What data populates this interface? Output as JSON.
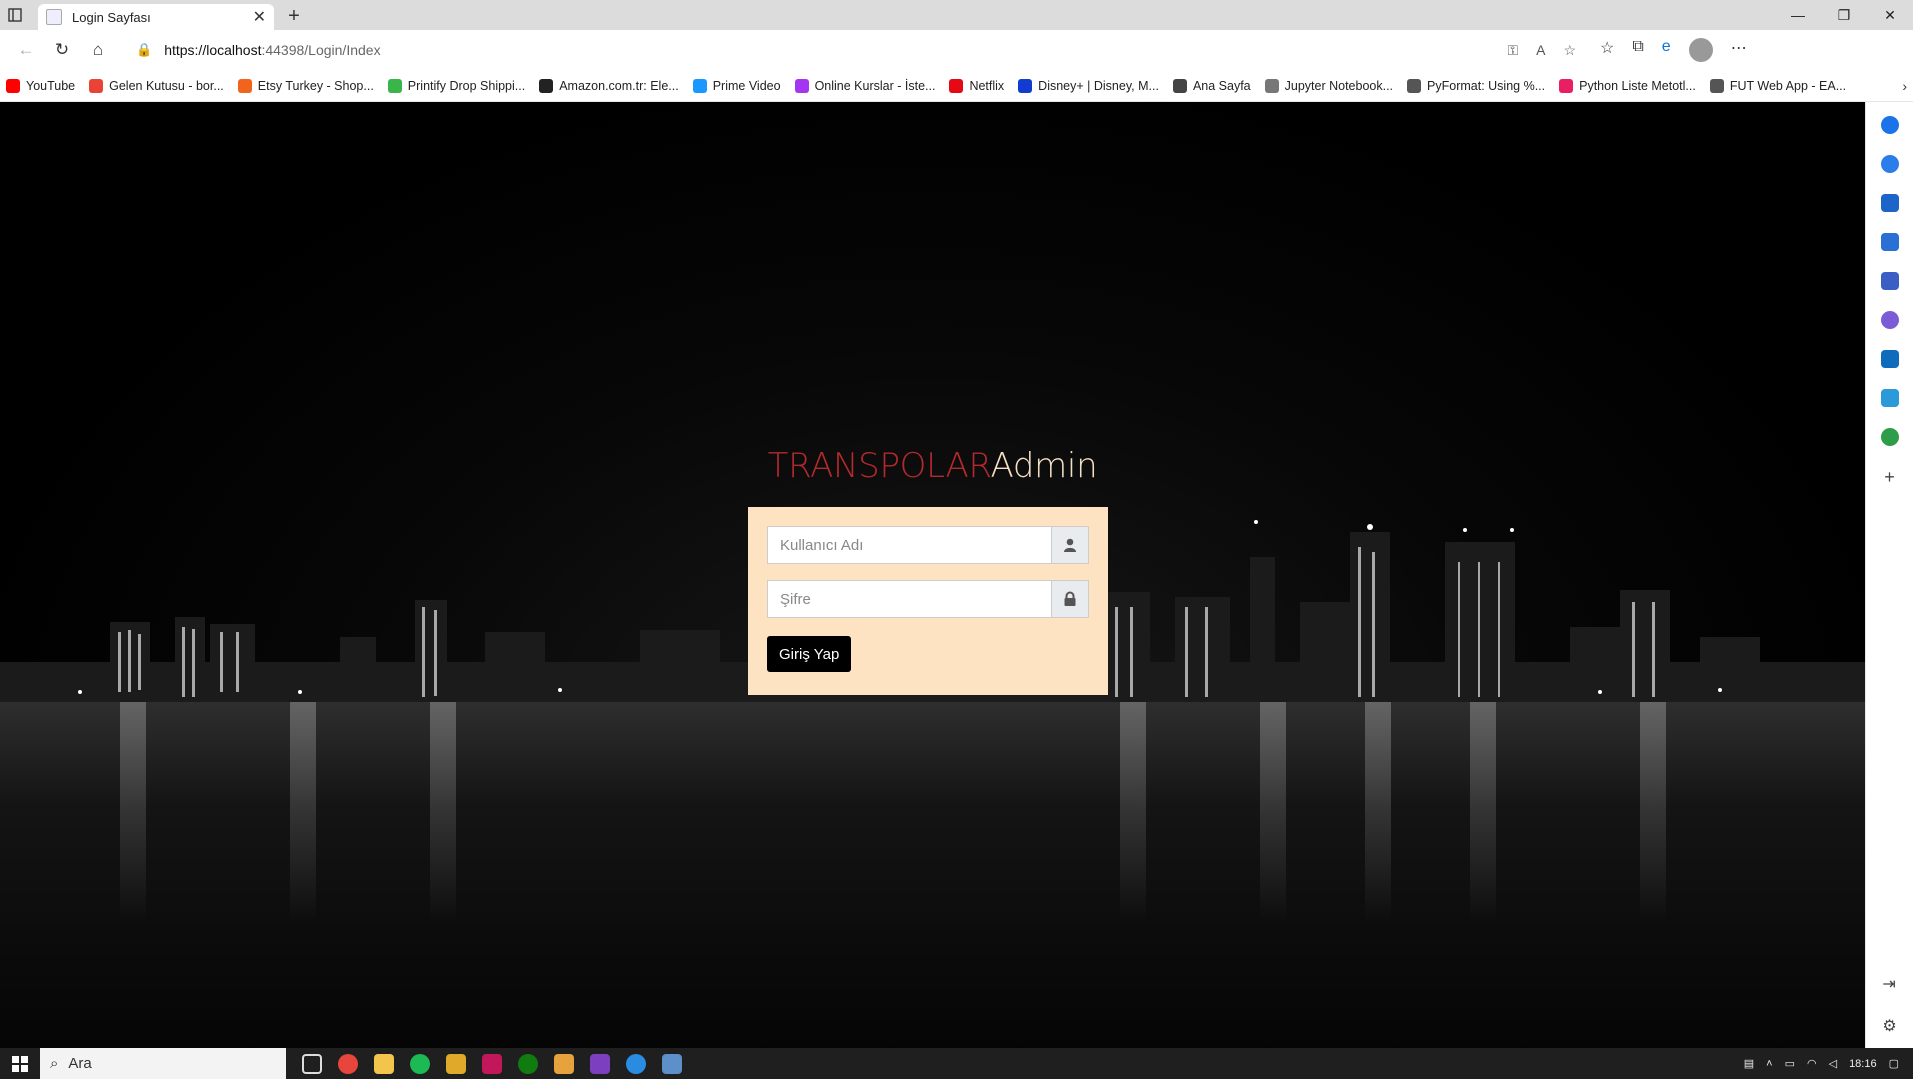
{
  "browser": {
    "tab_title": "Login Sayfası",
    "url_host": "https://localhost",
    "url_rest": ":44398/Login/Index",
    "new_tab": "+"
  },
  "bookmarks": [
    {
      "label": "YouTube",
      "color": "#ff0000"
    },
    {
      "label": "Gelen Kutusu - bor...",
      "color": "#ea4335"
    },
    {
      "label": "Etsy Turkey - Shop...",
      "color": "#f1641e"
    },
    {
      "label": "Printify Drop Shippi...",
      "color": "#39b54a"
    },
    {
      "label": "Amazon.com.tr: Ele...",
      "color": "#222222"
    },
    {
      "label": "Prime Video",
      "color": "#1a98ff"
    },
    {
      "label": "Online Kurslar - İste...",
      "color": "#a435f0"
    },
    {
      "label": "Netflix",
      "color": "#e50914"
    },
    {
      "label": "Disney+ | Disney, M...",
      "color": "#113ccf"
    },
    {
      "label": "Ana Sayfa",
      "color": "#444444"
    },
    {
      "label": "Jupyter Notebook...",
      "color": "#777777"
    },
    {
      "label": "PyFormat: Using %...",
      "color": "#555555"
    },
    {
      "label": "Python Liste Metotl...",
      "color": "#e91e63"
    },
    {
      "label": "FUT Web App - EA...",
      "color": "#555555"
    }
  ],
  "login": {
    "brand_primary": "TRANSPOLAR",
    "brand_secondary": "Admin",
    "username_placeholder": "Kullanıcı Adı",
    "password_placeholder": "Şifre",
    "submit_label": "Giriş Yap"
  },
  "taskbar": {
    "search_label": "Ara",
    "time": "18:16"
  },
  "colors": {
    "brand_red": "#b3292d",
    "brand_cream": "#f3dfc4",
    "panel_bg": "#fde3c2"
  }
}
